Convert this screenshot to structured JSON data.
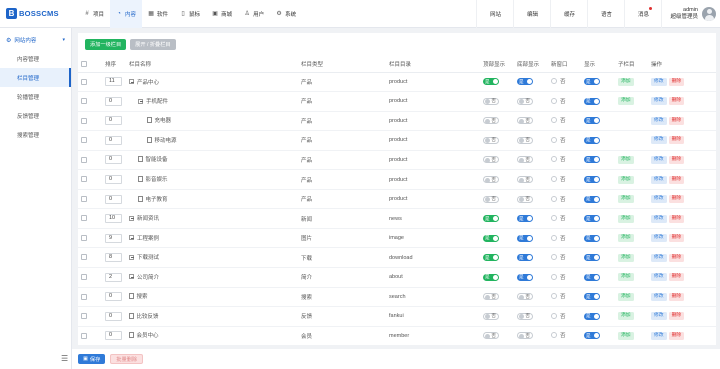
{
  "brand": {
    "name": "BOSSCMS"
  },
  "topnav": [
    {
      "label": "项目",
      "icon": "hash-icon",
      "active": false
    },
    {
      "label": "内容",
      "icon": "pie-icon",
      "active": true
    },
    {
      "label": "软件",
      "icon": "grid-icon",
      "active": false
    },
    {
      "label": "鼠标",
      "icon": "mouse-icon",
      "active": false
    },
    {
      "label": "商城",
      "icon": "bag-icon",
      "active": false
    },
    {
      "label": "用户",
      "icon": "user-icon",
      "active": false
    },
    {
      "label": "系统",
      "icon": "gear-icon",
      "active": false
    }
  ],
  "header_links": [
    "网站",
    "编辑",
    "缓存",
    "语言",
    "消息"
  ],
  "user": {
    "name": "admin",
    "role": "超级管理员"
  },
  "sidebar": {
    "group": "网站内容",
    "items": [
      "内容管理",
      "栏目管理",
      "轮播管理",
      "反馈管理",
      "搜索管理"
    ],
    "active_index": 1
  },
  "toolbar": {
    "add_label": "添加一级栏目",
    "expand_label": "展开 / 折叠栏目"
  },
  "columns": [
    "排序",
    "栏目名称",
    "栏目类型",
    "栏目目录",
    "顶部显示",
    "底部显示",
    "新窗口",
    "显示",
    "子栏目",
    "操作"
  ],
  "labels": {
    "yes": "是",
    "no": "否",
    "add": "添加",
    "edit": "修改",
    "delete": "删除"
  },
  "rows": [
    {
      "sort": "11",
      "name": "产品中心",
      "level": 0,
      "kind": "folder",
      "type": "产品",
      "dir": "product",
      "top": "是",
      "bottom": "是",
      "newwin": "否",
      "show": "是",
      "sub": true
    },
    {
      "sort": "0",
      "name": "手机配件",
      "level": 1,
      "kind": "folder",
      "type": "产品",
      "dir": "product",
      "top": "否",
      "bottom": "否",
      "newwin": "否",
      "show": "是",
      "sub": true
    },
    {
      "sort": "0",
      "name": "充电器",
      "level": 2,
      "kind": "doc",
      "type": "产品",
      "dir": "product",
      "top": "否",
      "bottom": "否",
      "newwin": "否",
      "show": "是",
      "sub": false
    },
    {
      "sort": "0",
      "name": "移动电源",
      "level": 2,
      "kind": "doc",
      "type": "产品",
      "dir": "product",
      "top": "否",
      "bottom": "否",
      "newwin": "否",
      "show": "是",
      "sub": false
    },
    {
      "sort": "0",
      "name": "智能设备",
      "level": 1,
      "kind": "doc",
      "type": "产品",
      "dir": "product",
      "top": "否",
      "bottom": "否",
      "newwin": "否",
      "show": "是",
      "sub": true
    },
    {
      "sort": "0",
      "name": "影音娱乐",
      "level": 1,
      "kind": "doc",
      "type": "产品",
      "dir": "product",
      "top": "否",
      "bottom": "否",
      "newwin": "否",
      "show": "是",
      "sub": true
    },
    {
      "sort": "0",
      "name": "电子教育",
      "level": 1,
      "kind": "doc",
      "type": "产品",
      "dir": "product",
      "top": "否",
      "bottom": "否",
      "newwin": "否",
      "show": "是",
      "sub": true
    },
    {
      "sort": "10",
      "name": "新闻资讯",
      "level": 0,
      "kind": "folder",
      "type": "新闻",
      "dir": "news",
      "top": "是",
      "bottom": "是",
      "newwin": "否",
      "show": "是",
      "sub": true
    },
    {
      "sort": "9",
      "name": "工程案例",
      "level": 0,
      "kind": "folder",
      "type": "图片",
      "dir": "image",
      "top": "是",
      "bottom": "是",
      "newwin": "否",
      "show": "是",
      "sub": true
    },
    {
      "sort": "8",
      "name": "下载测试",
      "level": 0,
      "kind": "folder",
      "type": "下载",
      "dir": "download",
      "top": "是",
      "bottom": "是",
      "newwin": "否",
      "show": "是",
      "sub": true
    },
    {
      "sort": "2",
      "name": "公司简介",
      "level": 0,
      "kind": "folder",
      "type": "简介",
      "dir": "about",
      "top": "是",
      "bottom": "是",
      "newwin": "否",
      "show": "是",
      "sub": true
    },
    {
      "sort": "0",
      "name": "搜索",
      "level": 0,
      "kind": "doc",
      "type": "搜索",
      "dir": "search",
      "top": "否",
      "bottom": "否",
      "newwin": "否",
      "show": "是",
      "sub": true
    },
    {
      "sort": "0",
      "name": "比较反馈",
      "level": 0,
      "kind": "doc",
      "type": "反馈",
      "dir": "fankui",
      "top": "否",
      "bottom": "否",
      "newwin": "否",
      "show": "是",
      "sub": true
    },
    {
      "sort": "0",
      "name": "会员中心",
      "level": 0,
      "kind": "doc",
      "type": "会员",
      "dir": "member",
      "top": "否",
      "bottom": "否",
      "newwin": "否",
      "show": "是",
      "sub": true
    }
  ],
  "footer": {
    "save_label": "保存",
    "delete_label": "批量删除"
  }
}
